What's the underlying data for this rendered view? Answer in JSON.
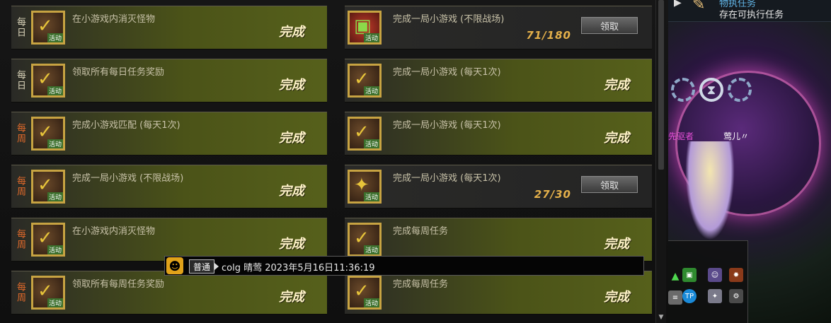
{
  "left_tasks": [
    {
      "period": "每日",
      "period_type": "daily",
      "title": "在小游戏内消灭怪物",
      "status": "完成",
      "icon": "activity-check-icon",
      "icon_tag": "活动"
    },
    {
      "period": "每日",
      "period_type": "daily",
      "title": "领取所有每日任务奖励",
      "status": "完成",
      "icon": "activity-check-icon",
      "icon_tag": "活动"
    },
    {
      "period": "每周",
      "period_type": "weekly",
      "title": "完成小游戏匹配 (每天1次)",
      "status": "完成",
      "icon": "activity-check-icon",
      "icon_tag": "活动"
    },
    {
      "period": "每周",
      "period_type": "weekly",
      "title": "完成一局小游戏 (不限战场)",
      "status": "完成",
      "icon": "activity-check-icon",
      "icon_tag": "活动"
    },
    {
      "period": "每周",
      "period_type": "weekly",
      "title": "在小游戏内消灭怪物",
      "status": "完成",
      "icon": "activity-check-icon",
      "icon_tag": "活动"
    },
    {
      "period": "每周",
      "period_type": "weekly",
      "title": "领取所有每周任务奖励",
      "status": "完成",
      "icon": "activity-check-icon",
      "icon_tag": "活动"
    }
  ],
  "right_tasks": [
    {
      "title": "完成一局小游戏 (不限战场)",
      "status": "",
      "progress": "71/180",
      "claim": "领取",
      "icon": "gift-icon",
      "icon_tag": "活动",
      "pending": true
    },
    {
      "title": "完成一局小游戏 (每天1次)",
      "status": "完成",
      "icon": "activity-check-icon",
      "icon_tag": "活动"
    },
    {
      "title": "完成一局小游戏 (每天1次)",
      "status": "完成",
      "icon": "activity-check-icon",
      "icon_tag": "活动"
    },
    {
      "title": "完成一局小游戏 (每天1次)",
      "status": "",
      "progress": "27/30",
      "claim": "领取",
      "icon": "activity-star-icon",
      "icon_tag": "活动",
      "pending": true
    },
    {
      "title": "完成每周任务",
      "status": "完成",
      "icon": "activity-check-icon",
      "icon_tag": "活动"
    },
    {
      "title": "完成每周任务",
      "status": "完成",
      "icon": "activity-check-icon",
      "icon_tag": "活动"
    }
  ],
  "side": {
    "header_line1": "物执任务",
    "header_line2": "存在可执行任务",
    "name_left": "先驱者",
    "name_right": "莺儿〃"
  },
  "chat": {
    "channel": "普通",
    "message": "colg 晴莺 2023年5月16日11:36:19"
  },
  "colors": {
    "complete_row": "#56601b",
    "pending_row": "#242424",
    "progress": "#e4b04a",
    "weekly": "#e26a2a"
  }
}
